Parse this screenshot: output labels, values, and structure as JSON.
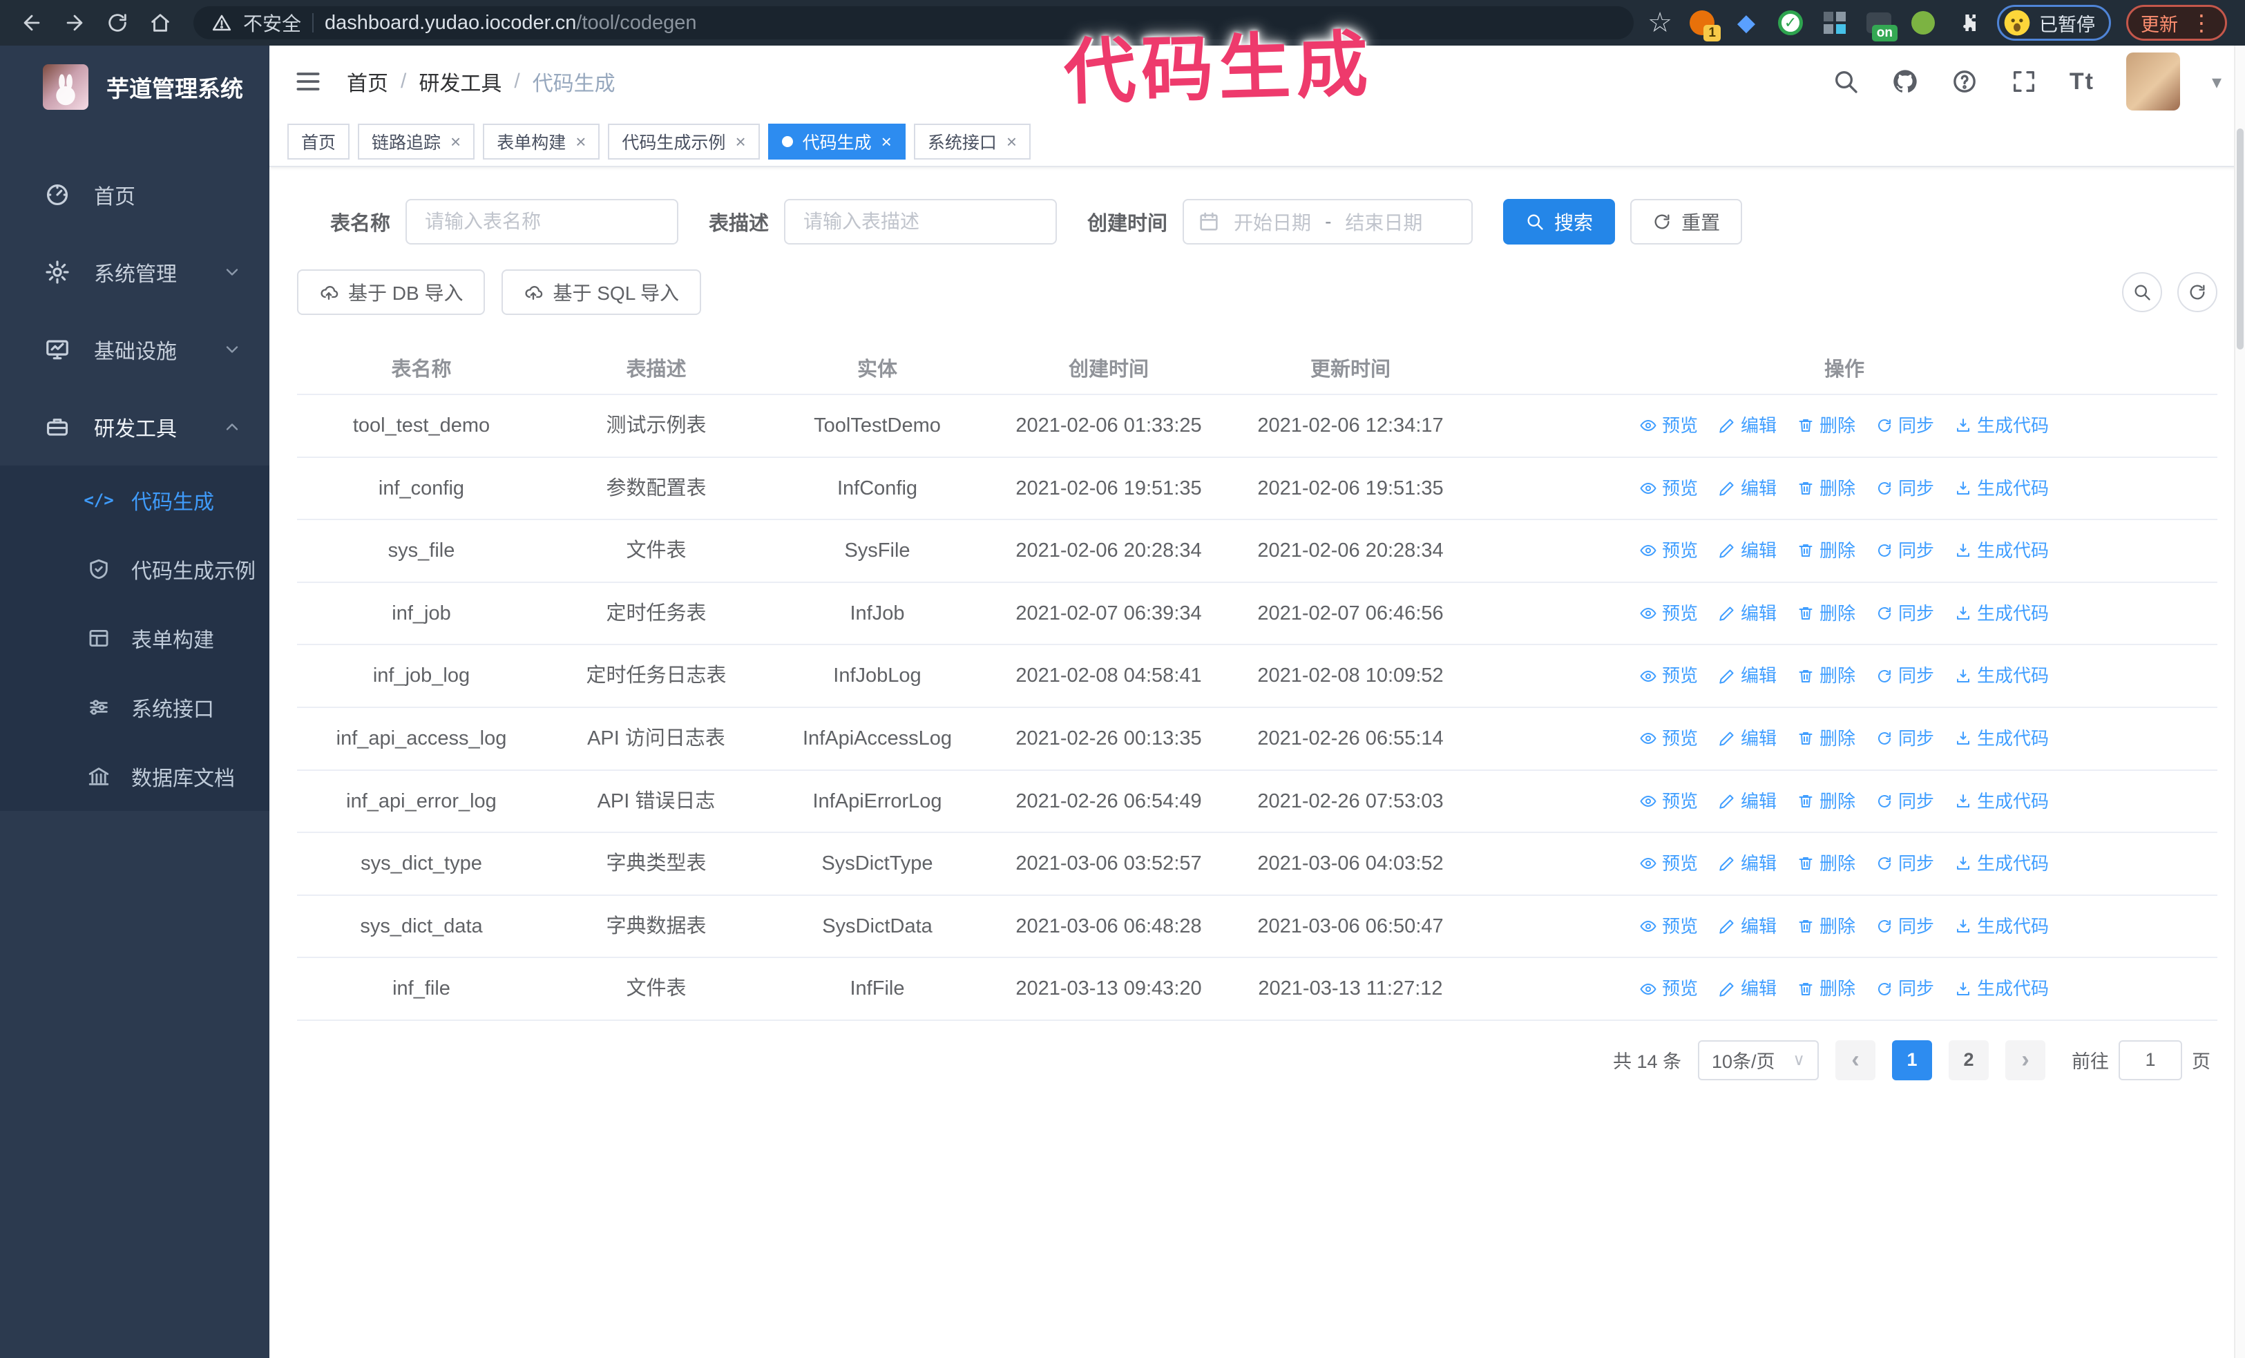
{
  "overlay": {
    "title": "代码生成",
    "color": "#ee3a6c"
  },
  "browser": {
    "security_label": "不安全",
    "url_host": "dashboard.yudao.iocoder.cn",
    "url_path": "/tool/codegen",
    "star": "☆",
    "extension_badge": "1",
    "extension_on_badge": "on",
    "profile_status": "已暂停",
    "update_label": "更新",
    "menu_dots": "⋮"
  },
  "sidebar": {
    "title": "芋道管理系统",
    "menu": [
      {
        "label": "首页"
      },
      {
        "label": "系统管理"
      },
      {
        "label": "基础设施"
      },
      {
        "label": "研发工具"
      }
    ],
    "submenu": [
      {
        "label": "代码生成"
      },
      {
        "label": "代码生成示例"
      },
      {
        "label": "表单构建"
      },
      {
        "label": "系统接口"
      },
      {
        "label": "数据库文档"
      }
    ],
    "code_glyph": "</>"
  },
  "breadcrumb": {
    "items": [
      "首页",
      "研发工具",
      "代码生成"
    ],
    "separator": "/"
  },
  "tabs": [
    {
      "label": "首页"
    },
    {
      "label": "链路追踪"
    },
    {
      "label": "表单构建"
    },
    {
      "label": "代码生成示例"
    },
    {
      "label": "代码生成"
    },
    {
      "label": "系统接口"
    }
  ],
  "ui": {
    "close": "×",
    "caret_down": "▾",
    "select_caret": "∨",
    "prev": "‹",
    "next": "›",
    "text_size_icon": "Tt"
  },
  "search": {
    "table_name_label": "表名称",
    "table_name_placeholder": "请输入表名称",
    "table_desc_label": "表描述",
    "table_desc_placeholder": "请输入表描述",
    "create_time_label": "创建时间",
    "date_start_placeholder": "开始日期",
    "date_separator": "-",
    "date_end_placeholder": "结束日期",
    "search_button": "搜索",
    "reset_button": "重置"
  },
  "toolbar": {
    "db_import": "基于 DB 导入",
    "sql_import": "基于 SQL 导入"
  },
  "table": {
    "columns": [
      "表名称",
      "表描述",
      "实体",
      "创建时间",
      "更新时间",
      "操作"
    ],
    "actions": [
      "预览",
      "编辑",
      "删除",
      "同步",
      "生成代码"
    ],
    "rows": [
      [
        "tool_test_demo",
        "测试示例表",
        "ToolTestDemo",
        "2021-02-06 01:33:25",
        "2021-02-06 12:34:17"
      ],
      [
        "inf_config",
        "参数配置表",
        "InfConfig",
        "2021-02-06 19:51:35",
        "2021-02-06 19:51:35"
      ],
      [
        "sys_file",
        "文件表",
        "SysFile",
        "2021-02-06 20:28:34",
        "2021-02-06 20:28:34"
      ],
      [
        "inf_job",
        "定时任务表",
        "InfJob",
        "2021-02-07 06:39:34",
        "2021-02-07 06:46:56"
      ],
      [
        "inf_job_log",
        "定时任务日志表",
        "InfJobLog",
        "2021-02-08 04:58:41",
        "2021-02-08 10:09:52"
      ],
      [
        "inf_api_access_log",
        "API 访问日志表",
        "InfApiAccessLog",
        "2021-02-26 00:13:35",
        "2021-02-26 06:55:14"
      ],
      [
        "inf_api_error_log",
        "API 错误日志",
        "InfApiErrorLog",
        "2021-02-26 06:54:49",
        "2021-02-26 07:53:03"
      ],
      [
        "sys_dict_type",
        "字典类型表",
        "SysDictType",
        "2021-03-06 03:52:57",
        "2021-03-06 04:03:52"
      ],
      [
        "sys_dict_data",
        "字典数据表",
        "SysDictData",
        "2021-03-06 06:48:28",
        "2021-03-06 06:50:47"
      ],
      [
        "inf_file",
        "文件表",
        "InfFile",
        "2021-03-13 09:43:20",
        "2021-03-13 11:27:12"
      ]
    ]
  },
  "pagination": {
    "total": "共 14 条",
    "page_size": "10条/页",
    "pages": [
      "1",
      "2"
    ],
    "active_page": "1",
    "goto_label": "前往",
    "goto_value": "1",
    "page_unit": "页"
  },
  "colors": {
    "accent_blue": "#2d8cf0",
    "link_blue": "#409eff",
    "sidebar_bg": "#2c3a4f",
    "submenu_bg": "#243247",
    "browser_bar_bg": "#222d38",
    "overlay_pink": "#ee3a6c"
  }
}
